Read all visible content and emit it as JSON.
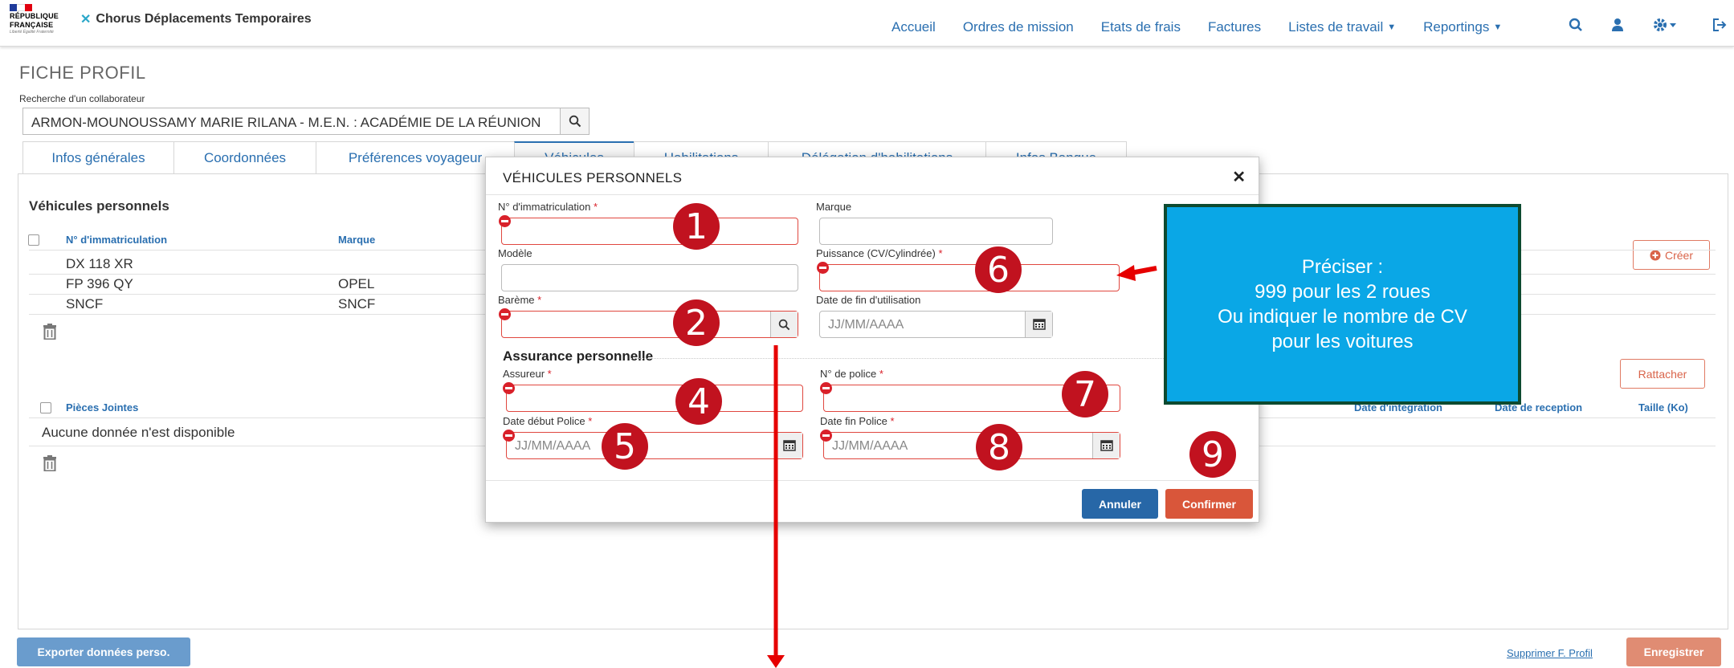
{
  "header": {
    "republique_line1": "RÉPUBLIQUE",
    "republique_line2": "FRANÇAISE",
    "motto": "Liberté Égalité Fraternité",
    "app_title": "Chorus Déplacements Temporaires",
    "nav": [
      "Accueil",
      "Ordres de mission",
      "Etats de frais",
      "Factures",
      "Listes de travail",
      "Reportings"
    ],
    "icons": [
      "search-icon",
      "user-icon",
      "gear-icon",
      "logout-icon"
    ]
  },
  "page": {
    "title": "FICHE PROFIL",
    "search_label": "Recherche d'un collaborateur",
    "search_value": "ARMON-MOUNOUSSAMY MARIE RILANA - M.E.N. : ACADÉMIE DE LA RÉUNION",
    "tabs": [
      "Infos générales",
      "Coordonnées",
      "Préférences voyageur",
      "Véhicules",
      "Habilitations",
      "Délégation d'habilitations",
      "Infos Banque"
    ],
    "active_tab": "Véhicules"
  },
  "vehicles": {
    "title": "Véhicules personnels",
    "col_immat": "N° d'immatriculation",
    "col_marque": "Marque",
    "create_button": "Créer",
    "rows": [
      {
        "immat": "DX 118 XR",
        "marque": ""
      },
      {
        "immat": "FP 396 QY",
        "marque": "OPEL"
      },
      {
        "immat": "SNCF",
        "marque": "SNCF"
      }
    ]
  },
  "attachments": {
    "col_pieces": "Pièces Jointes",
    "col_integration": "Date d'integration",
    "col_reception": "Date de reception",
    "col_taille": "Taille (Ko)",
    "attach_button": "Rattacher",
    "empty_text": "Aucune donnée n'est disponible"
  },
  "footer": {
    "export_button": "Exporter données perso.",
    "delete_link": "Supprimer F. Profil",
    "save_button": "Enregistrer"
  },
  "modal": {
    "title": "VÉHICULES PERSONNELS",
    "immat_label": "N° d'immatriculation",
    "marque_label": "Marque",
    "modele_label": "Modèle",
    "puissance_label": "Puissance (CV/Cylindrée)",
    "bareme_label": "Barème",
    "date_fin_label": "Date de fin d'utilisation",
    "date_placeholder": "JJ/MM/AAAA",
    "assurance_title": "Assurance personnelle",
    "assureur_label": "Assureur",
    "police_label": "N° de police",
    "debut_police_label": "Date début Police",
    "fin_police_label": "Date fin Police",
    "req_mark": "*",
    "cancel_button": "Annuler",
    "confirm_button": "Confirmer"
  },
  "annotations": {
    "badges": [
      "1",
      "2",
      "4",
      "5",
      "6",
      "7",
      "8",
      "9"
    ],
    "callout": [
      "Préciser :",
      "999 pour les 2 roues",
      "Ou indiquer le nombre de CV",
      "pour les voitures"
    ],
    "arrow_color": "#e60000",
    "badge_color": "#c1121f"
  }
}
